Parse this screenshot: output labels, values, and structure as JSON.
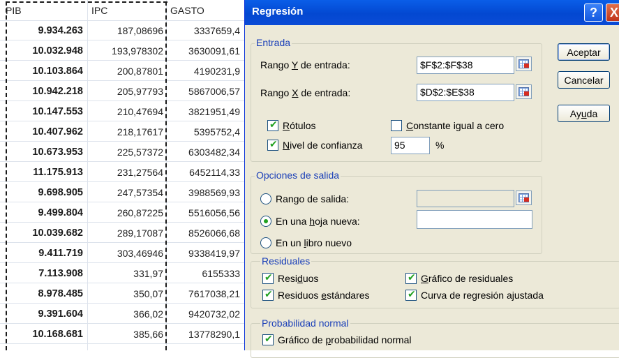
{
  "sheet": {
    "headers": {
      "pib": "PIB",
      "ipc": "IPC",
      "gasto": "GASTO"
    },
    "rows": [
      {
        "pib": "9.934.263",
        "ipc": "187,08696",
        "gasto": "3337659,4"
      },
      {
        "pib": "10.032.948",
        "ipc": "193,978302",
        "gasto": "3630091,61"
      },
      {
        "pib": "10.103.864",
        "ipc": "200,87801",
        "gasto": "4190231,9"
      },
      {
        "pib": "10.942.218",
        "ipc": "205,97793",
        "gasto": "5867006,57"
      },
      {
        "pib": "10.147.553",
        "ipc": "210,47694",
        "gasto": "3821951,49"
      },
      {
        "pib": "10.407.962",
        "ipc": "218,17617",
        "gasto": "5395752,4"
      },
      {
        "pib": "10.673.953",
        "ipc": "225,57372",
        "gasto": "6303482,34"
      },
      {
        "pib": "11.175.913",
        "ipc": "231,27564",
        "gasto": "6452114,33"
      },
      {
        "pib": "9.698.905",
        "ipc": "247,57354",
        "gasto": "3988569,93"
      },
      {
        "pib": "9.499.804",
        "ipc": "260,87225",
        "gasto": "5516056,56"
      },
      {
        "pib": "10.039.682",
        "ipc": "289,17087",
        "gasto": "8526066,68"
      },
      {
        "pib": "9.411.719",
        "ipc": "303,46946",
        "gasto": "9338419,97"
      },
      {
        "pib": "7.113.908",
        "ipc": "331,97",
        "gasto": "6155333"
      },
      {
        "pib": "8.978.485",
        "ipc": "350,07",
        "gasto": "7617038,21"
      },
      {
        "pib": "9.391.604",
        "ipc": "366,02",
        "gasto": "9420732,02"
      },
      {
        "pib": "10.168.681",
        "ipc": "385,66",
        "gasto": "13778290,1"
      }
    ]
  },
  "dialog": {
    "title": "Regresión",
    "help_label": "?",
    "close_label": "X",
    "entrada": {
      "group_label": "Entrada",
      "rango_y": {
        "pre": "Rango ",
        "key": "Y",
        "post": " de entrada:",
        "value": "$F$2:$F$38"
      },
      "rango_x": {
        "pre": "Rango ",
        "key": "X",
        "post": " de entrada:",
        "value": "$D$2:$E$38"
      },
      "rotulos": {
        "key": "R",
        "post": "ótulos",
        "checked": true
      },
      "constante": {
        "key": "C",
        "post": "onstante igual a cero",
        "checked": false
      },
      "nivel": {
        "key": "N",
        "post": "ivel de confianza",
        "checked": true,
        "value": "95",
        "unit": "%"
      }
    },
    "salida": {
      "group_label": "Opciones de salida",
      "rango_salida": {
        "label": "Rango de salida:",
        "selected": false
      },
      "hoja_nueva": {
        "pre": "En una ",
        "key": "h",
        "post": "oja nueva:",
        "selected": true
      },
      "libro_nuevo": {
        "pre": "En un ",
        "key": "l",
        "post": "ibro nuevo",
        "selected": false
      }
    },
    "residuales": {
      "group_label": "Residuales",
      "residuos": {
        "pre": "Resi",
        "key": "d",
        "post": "uos",
        "checked": true
      },
      "residuos_est": {
        "pre": "Residuos ",
        "key": "e",
        "post": "stándares",
        "checked": true
      },
      "grafico_res": {
        "pre": "",
        "key": "G",
        "post": "ráfico de residuales",
        "checked": true
      },
      "curva": {
        "pre": "Curva de regresión a",
        "key": "j",
        "post": "ustada",
        "checked": true
      }
    },
    "probabilidad": {
      "group_label": "Probabilidad normal",
      "grafico_prob": {
        "pre": "Gráfico de ",
        "key": "p",
        "post": "robabilidad normal",
        "checked": true
      }
    },
    "buttons": {
      "aceptar": "Aceptar",
      "cancelar": "Cancelar",
      "ayuda_pre": "Ay",
      "ayuda_key": "u",
      "ayuda_post": "da"
    }
  }
}
